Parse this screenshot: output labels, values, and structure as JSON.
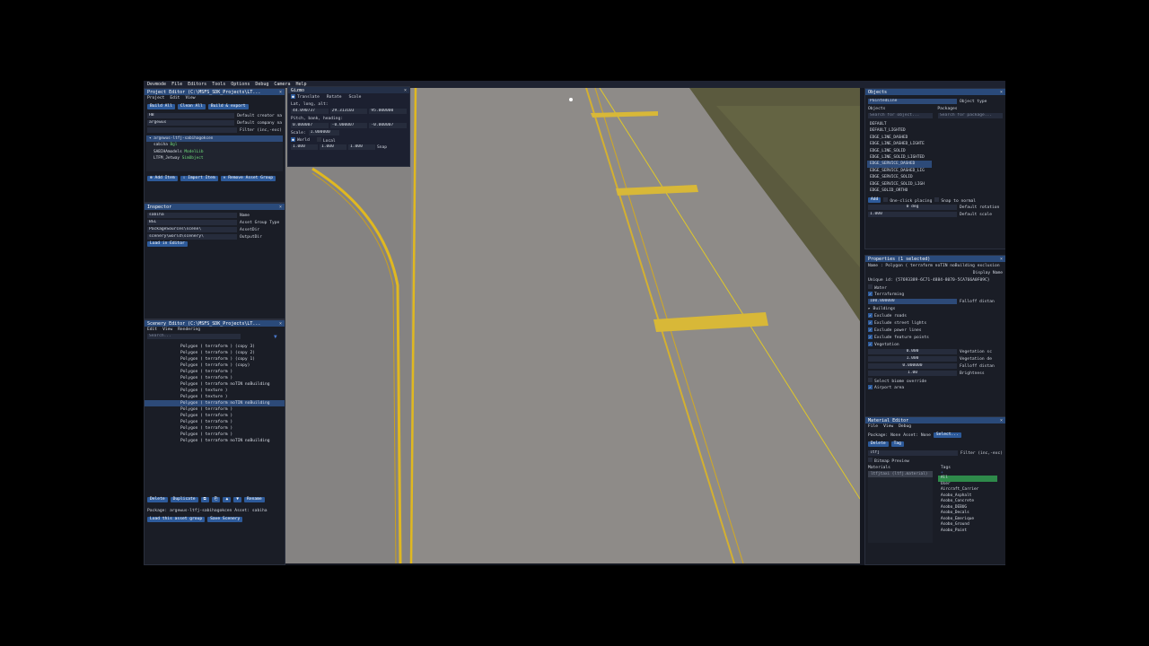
{
  "menubar": [
    "Devmode",
    "File",
    "Editors",
    "Tools",
    "Options",
    "Debug",
    "Camera",
    "Help"
  ],
  "gizmo": {
    "title": "Gizmo",
    "modes": [
      "Translate",
      "Rotate",
      "Scale"
    ],
    "lla_label": "Lat, long, alt:",
    "lla": [
      "44.090737",
      "29.313103",
      "95.000000"
    ],
    "pbh_label": "Pitch, bank, heading:",
    "pbh": [
      "0.000007",
      "-0.000007",
      "-0.000007"
    ],
    "scale_label": "Scale:",
    "scale": "1.000000",
    "space": [
      "World",
      "Local"
    ],
    "snap_values": [
      "1.000",
      "1.000",
      "1.000"
    ],
    "snap_label": "Snap"
  },
  "project_editor": {
    "title": "Project Editor (C:\\MSFS_SDK_Projects\\LT...",
    "menu": [
      "Project",
      "Edit",
      "View"
    ],
    "buttons": [
      "Build All",
      "Clean All",
      "Build & export"
    ],
    "fields": [
      {
        "value": "HB",
        "label": "Default creator na"
      },
      {
        "value": "argewus",
        "label": "Default company na"
      },
      {
        "value": "",
        "label": "Filter (inc,-exc)"
      }
    ],
    "tree": [
      {
        "text": "argewus-ltfj-sabihagokcen",
        "green": "",
        "sel": true,
        "indent": 0
      },
      {
        "text": "sabiha",
        "green": "Bgl",
        "sel": false,
        "indent": 1
      },
      {
        "text": "SABIHAmodels",
        "green": "ModelLib",
        "sel": false,
        "indent": 1
      },
      {
        "text": "LTFM_Jetway",
        "green": "SimObject",
        "sel": false,
        "indent": 1
      }
    ],
    "actions": [
      "Add Item",
      "Import Item",
      "Remove Asset Group"
    ]
  },
  "inspector": {
    "title": "Inspector",
    "rows": [
      {
        "value": "sabiha",
        "label": "Name"
      },
      {
        "value": "BGL",
        "label": "Asset Group Type"
      },
      {
        "value": "PackageSources\\scene\\",
        "label": "AssetDir"
      },
      {
        "value": "scenery\\world\\scenery\\",
        "label": "OutputDir"
      }
    ],
    "load_button": "Load in Editor"
  },
  "scenery_editor": {
    "title": "Scenery Editor (C:\\MSFS_SDK_Projects\\LT...",
    "menu": [
      "Edit",
      "View",
      "Rendering"
    ],
    "search_placeholder": "Search...",
    "items": [
      {
        "text": "Polygon  ( terraform ) (copy 3)",
        "sel": false
      },
      {
        "text": "Polygon  ( terraform ) (copy 2)",
        "sel": false
      },
      {
        "text": "Polygon  ( terraform ) (copy 1)",
        "sel": false
      },
      {
        "text": "Polygon  ( terraform ) (copy)",
        "sel": false
      },
      {
        "text": "Polygon  ( terraform )",
        "sel": false
      },
      {
        "text": "Polygon  ( terraform )",
        "sel": false
      },
      {
        "text": "Polygon  ( terraform noTIN noBuilding",
        "sel": false
      },
      {
        "text": "Polygon  ( texture )",
        "sel": false
      },
      {
        "text": "Polygon  ( texture )",
        "sel": false
      },
      {
        "text": "Polygon  ( terraform noTIN noBuilding",
        "sel": true
      },
      {
        "text": "Polygon  ( terraform )",
        "sel": false
      },
      {
        "text": "Polygon  ( terraform )",
        "sel": false
      },
      {
        "text": "Polygon  ( terraform )",
        "sel": false
      },
      {
        "text": "Polygon  ( terraform )",
        "sel": false
      },
      {
        "text": "Polygon  ( terraform )",
        "sel": false
      },
      {
        "text": "Polygon  ( terraform noTIN noBuilding",
        "sel": false
      }
    ],
    "actions": [
      "Delete",
      "Duplicate",
      "Rename"
    ],
    "package_label": "Package:",
    "package_value": "argewus-ltfj-sabihagokcen",
    "asset_label": "Asset:",
    "asset_value": "sabiha",
    "bottom_buttons": [
      "Load this asset group",
      "Save Scenery"
    ]
  },
  "objects": {
    "title": "Objects",
    "type_value": "PaintedLine",
    "type_label": "Object type",
    "objects_header": "Objects",
    "packages_header": "Packages",
    "search_obj": "Search for object...",
    "search_pkg": "Search for package...",
    "list": [
      {
        "text": "DEFAULT",
        "sel": false
      },
      {
        "text": "DEFAULT_LIGHTED",
        "sel": false
      },
      {
        "text": "EDGE_LINE_DASHED",
        "sel": false
      },
      {
        "text": "EDGE_LINE_DASHED_LIGHTE",
        "sel": false
      },
      {
        "text": "EDGE_LINE_SOLID",
        "sel": false
      },
      {
        "text": "EDGE_LINE_SOLID_LIGHTED",
        "sel": false
      },
      {
        "text": "EDGE_SERVICE_DASHED",
        "sel": true
      },
      {
        "text": "EDGE_SERVICE_DASHED_LIG",
        "sel": false
      },
      {
        "text": "EDGE_SERVICE_SOLID",
        "sel": false
      },
      {
        "text": "EDGE_SERVICE_SOLID_LIGH",
        "sel": false
      },
      {
        "text": "EDGE_SOLID_ORTHO",
        "sel": false
      }
    ],
    "add_button": "Add",
    "one_click": "One-click placing",
    "snap_normal": "Snap to normal",
    "rotation_value": "0 deg",
    "rotation_label": "Default rotation",
    "scale_value": "1.000",
    "scale_label": "Default scale"
  },
  "properties": {
    "title": "Properties (1 selected)",
    "name_line": "Name : Polygon  ( terraform noTIN noBuilding exclusion",
    "display_name": "Display Name",
    "unique_id": "Unique id: {57693389-6C71-4884-8070-5CA766A0F09C}",
    "water": "Water",
    "terraforming": "Terraforming",
    "falloff_value": "100.000000",
    "falloff_label": "Falloff distan",
    "buildings": "Buildings",
    "checks": [
      "Exclude roads",
      "Exclude street lights",
      "Exclude power lines",
      "Exclude feature points",
      "Vegetation"
    ],
    "veg_sliders": [
      {
        "value": "0.000",
        "label": "Vegetation sc"
      },
      {
        "value": "1.000",
        "label": "Vegetation de"
      },
      {
        "value": "0.000000",
        "label": "Falloff distan"
      },
      {
        "value": "1.00",
        "label": "Brightness"
      }
    ],
    "biome": "Select biome override",
    "airport": "Airport area"
  },
  "material_editor": {
    "title": "Material Editor",
    "menu": [
      "File",
      "View",
      "Debug"
    ],
    "package_label": "Package:",
    "package_value": "None",
    "asset_label": "Asset:",
    "asset_value": "None",
    "select_button": "Select...",
    "buttons": [
      "Delete",
      "Tag"
    ],
    "filter_value": "ltfj",
    "filter_label": "Filter (inc,-exc)",
    "bitmap_preview": "Bitmap Preview",
    "materials_header": "Materials",
    "tags_header": "Tags",
    "material_item": "ltfjtaxi (ltfj.material)",
    "tags": [
      "All",
      "User",
      "Aircraft_Carrier",
      "Asobo_Asphalt",
      "Asobo_Concrete",
      "Asobo_DEBUG",
      "Asobo_Decals",
      "Asobo_Emerique",
      "Asobo_Ground",
      "Asobo_Paint"
    ]
  },
  "colors": {
    "accent": "#2d5a9a",
    "title": "#2a4a7a",
    "asphalt": "#8a8784",
    "line_yellow": "#e0b820"
  }
}
